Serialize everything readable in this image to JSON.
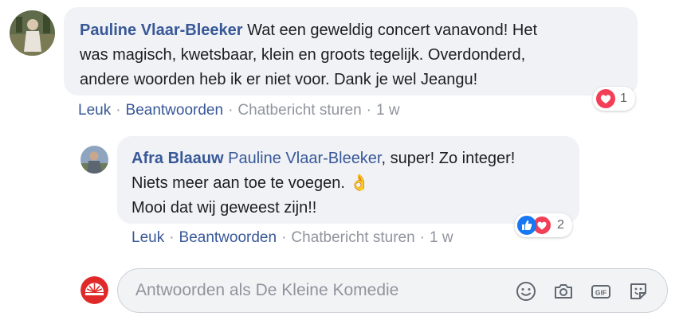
{
  "comment": {
    "author": "Pauline Vlaar-Bleeker",
    "lines": [
      "Wat een geweldig concert vanavond! Het",
      "was magisch, kwetsbaar, klein en groots tegelijk. Overdonderd,",
      "andere woorden heb ik er niet voor. Dank je wel Jeangu!"
    ],
    "actions": {
      "like": "Leuk",
      "reply": "Beantwoorden",
      "message": "Chatbericht sturen",
      "time": "1 w"
    },
    "reaction_count": "1",
    "reaction_icons": [
      "heart-love-icon"
    ]
  },
  "reply": {
    "author": "Afra Blaauw",
    "mention": "Pauline Vlaar-Bleeker",
    "lines": [
      ", super! Zo integer!",
      "Niets meer aan toe te voegen. ",
      "Mooi dat wij geweest zijn!!"
    ],
    "emoji": "👌",
    "actions": {
      "like": "Leuk",
      "reply": "Beantwoorden",
      "message": "Chatbericht sturen",
      "time": "1 w"
    },
    "reaction_count": "2",
    "reaction_icons": [
      "like-thumb-icon",
      "heart-love-icon"
    ]
  },
  "composer": {
    "placeholder": "Antwoorden als De Kleine Komedie",
    "icons": [
      "emoji-smiley-icon",
      "camera-icon",
      "gif-icon",
      "sticker-icon"
    ]
  },
  "colors": {
    "link": "#385898",
    "meta": "#90949c",
    "bubble": "#f0f2f5",
    "love": "#f33e58",
    "like": "#1877f2"
  }
}
